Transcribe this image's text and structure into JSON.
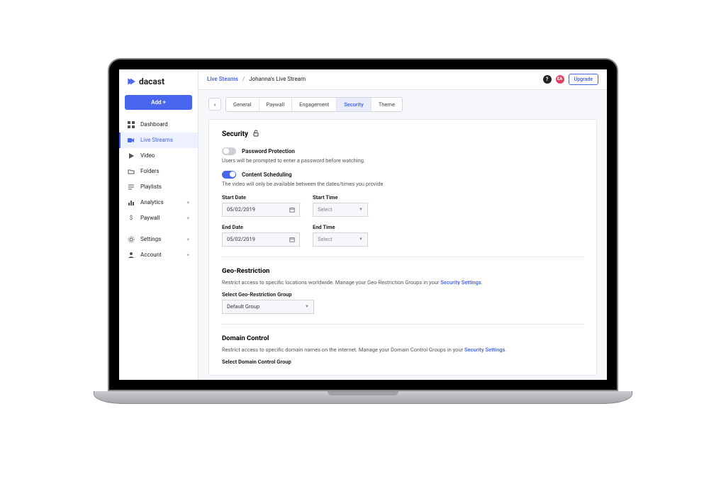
{
  "brand": "dacast",
  "sidebar": {
    "add_button": "Add +",
    "items": [
      {
        "label": "Dashboard"
      },
      {
        "label": "Live Streams"
      },
      {
        "label": "Video"
      },
      {
        "label": "Folders"
      },
      {
        "label": "Playlists"
      },
      {
        "label": "Analytics"
      },
      {
        "label": "Paywall"
      },
      {
        "label": "Settings"
      },
      {
        "label": "Account"
      }
    ]
  },
  "header": {
    "breadcrumb_root": "Live Steams",
    "breadcrumb_sep": "/",
    "breadcrumb_current": "Johanna's Live Stream",
    "avatar": "EA",
    "upgrade": "Upgrade"
  },
  "tabs": [
    "General",
    "Paywall",
    "Engagement",
    "Security",
    "Theme"
  ],
  "security": {
    "heading": "Security",
    "password": {
      "label": "Password Protection",
      "helper": "Users will be prompted to enter a password before watching."
    },
    "scheduling": {
      "label": "Content Scheduling",
      "helper": "The video will only be available between the dates/times you provide",
      "start_date_label": "Start Date",
      "start_date_value": "05/02/2019",
      "start_time_label": "Start Time",
      "start_time_value": "Select",
      "end_date_label": "End Date",
      "end_date_value": "05/02/2019",
      "end_time_label": "End Time",
      "end_time_value": "Select"
    },
    "geo": {
      "heading": "Geo-Restriction",
      "body_pre": "Restrict access to specific locations worldwide. Manage your Geo-Restriction Groups in your ",
      "body_link": "Security Settings",
      "body_post": ".",
      "select_label": "Select Geo-Restriction Group",
      "select_value": "Default Group"
    },
    "domain": {
      "heading": "Domain Control",
      "body_pre": "Restrict access to specific domain names on the internet. Manage your Domain Control Groups in your ",
      "body_link": "Security Settings",
      "body_post": ".",
      "select_label": "Select Domain Control Group"
    }
  }
}
